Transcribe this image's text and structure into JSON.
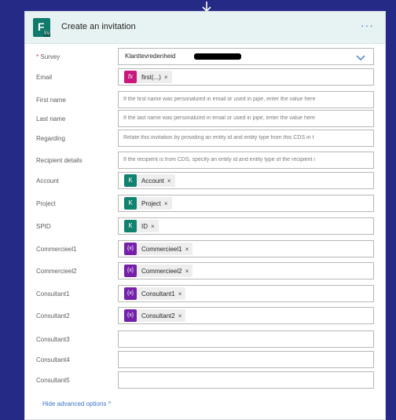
{
  "header": {
    "title": "Create an invitation",
    "more": "···",
    "icon_letter": "F",
    "icon_sub": "SV"
  },
  "fields": {
    "survey": {
      "required": "*",
      "label": "Survey",
      "value": "Klanttevredenheid"
    },
    "email": {
      "label": "Email",
      "token": {
        "label": "first(...)",
        "icon": "fx",
        "remove": "×"
      }
    },
    "first_name": {
      "label": "First name",
      "placeholder": "If the first name was personalized in email or used in pipe, enter the value here"
    },
    "last_name": {
      "label": "Last name",
      "placeholder": "If the last name was personalized in email or used in pipe, enter the value here"
    },
    "regarding": {
      "label": "Regarding",
      "placeholder": "Relate this invitation by providing an entity id and entity type from this CDS in t"
    },
    "recipient_details": {
      "label": "Recipient details",
      "placeholder": "If the recipient is from CDS, specify an entity id and entity type of the recipient i"
    },
    "account": {
      "label": "Account",
      "token": {
        "label": "Account",
        "icon": "K",
        "remove": "×"
      }
    },
    "project": {
      "label": "Project",
      "token": {
        "label": "Project",
        "icon": "K",
        "remove": "×"
      }
    },
    "spid": {
      "label": "SPID",
      "token": {
        "label": "ID",
        "icon": "K",
        "remove": "×"
      }
    },
    "commercieel1": {
      "label": "Commercieel1",
      "token": {
        "label": "Commercieel1",
        "icon": "{x}",
        "remove": "×"
      }
    },
    "commercieel2": {
      "label": "Commercieel2",
      "token": {
        "label": "Commercieel2",
        "icon": "{x}",
        "remove": "×"
      }
    },
    "consultant1": {
      "label": "Consultant1",
      "token": {
        "label": "Consultant1",
        "icon": "{x}",
        "remove": "×"
      }
    },
    "consultant2": {
      "label": "Consultant2",
      "token": {
        "label": "Consultant2",
        "icon": "{x}",
        "remove": "×"
      }
    },
    "consultant3": {
      "label": "Consultant3"
    },
    "consultant4": {
      "label": "Consultant4"
    },
    "consultant5": {
      "label": "Consultant5"
    }
  },
  "advanced_toggle": {
    "label": "Hide advanced options ^"
  },
  "colors": {
    "background": "#252a86",
    "header_bg": "#e7f3f2",
    "expression": "#c8177d",
    "dynamic_content": "#128270",
    "variable": "#7520a8",
    "link": "#3b74c8"
  }
}
